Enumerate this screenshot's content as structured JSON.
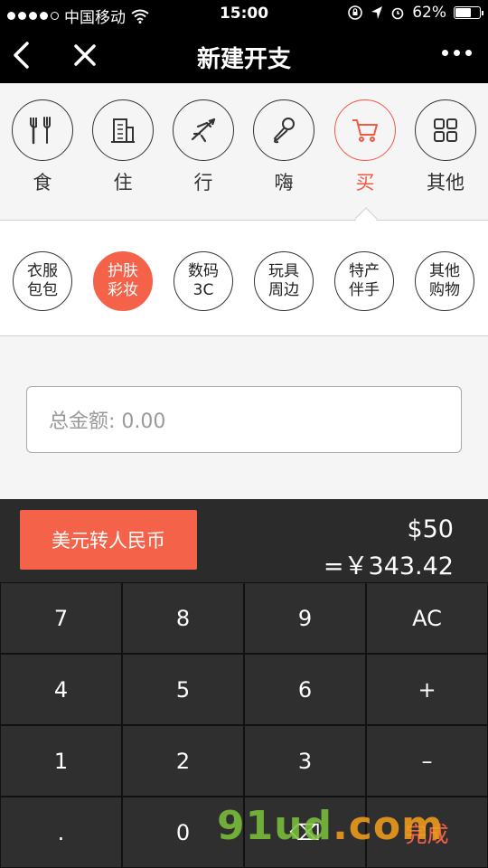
{
  "status": {
    "carrier": "中国移动",
    "time": "15:00",
    "battery": "62%",
    "battery_level": 0.62
  },
  "nav": {
    "title": "新建开支"
  },
  "categories": [
    {
      "label": "食",
      "icon": "fork-knife-icon",
      "active": false
    },
    {
      "label": "住",
      "icon": "building-icon",
      "active": false
    },
    {
      "label": "行",
      "icon": "airplane-icon",
      "active": false
    },
    {
      "label": "嗨",
      "icon": "microphone-icon",
      "active": false
    },
    {
      "label": "买",
      "icon": "shopping-cart-icon",
      "active": true
    },
    {
      "label": "其他",
      "icon": "grid-icon",
      "active": false
    }
  ],
  "subcategories": [
    {
      "line1": "衣服",
      "line2": "包包",
      "active": false
    },
    {
      "line1": "护肤",
      "line2": "彩妆",
      "active": true
    },
    {
      "line1": "数码",
      "line2": "3C",
      "active": false
    },
    {
      "line1": "玩具",
      "line2": "周边",
      "active": false
    },
    {
      "line1": "特产",
      "line2": "伴手",
      "active": false
    },
    {
      "line1": "其他",
      "line2": "购物",
      "active": false
    }
  ],
  "amount": {
    "label": "总金额: 0.00"
  },
  "converter": {
    "button": "美元转人民币",
    "usd": "$50",
    "cny": "=￥343.42"
  },
  "keypad": [
    [
      "7",
      "8",
      "9",
      "AC"
    ],
    [
      "4",
      "5",
      "6",
      "+"
    ],
    [
      "1",
      "2",
      "3",
      "–"
    ],
    [
      ".",
      "0",
      "⌫",
      "完成"
    ]
  ],
  "colors": {
    "accent": "#f5624a",
    "keypad_bg": "#2f2f2f"
  },
  "watermark": {
    "text": "91ud",
    "suffix": ".com"
  }
}
